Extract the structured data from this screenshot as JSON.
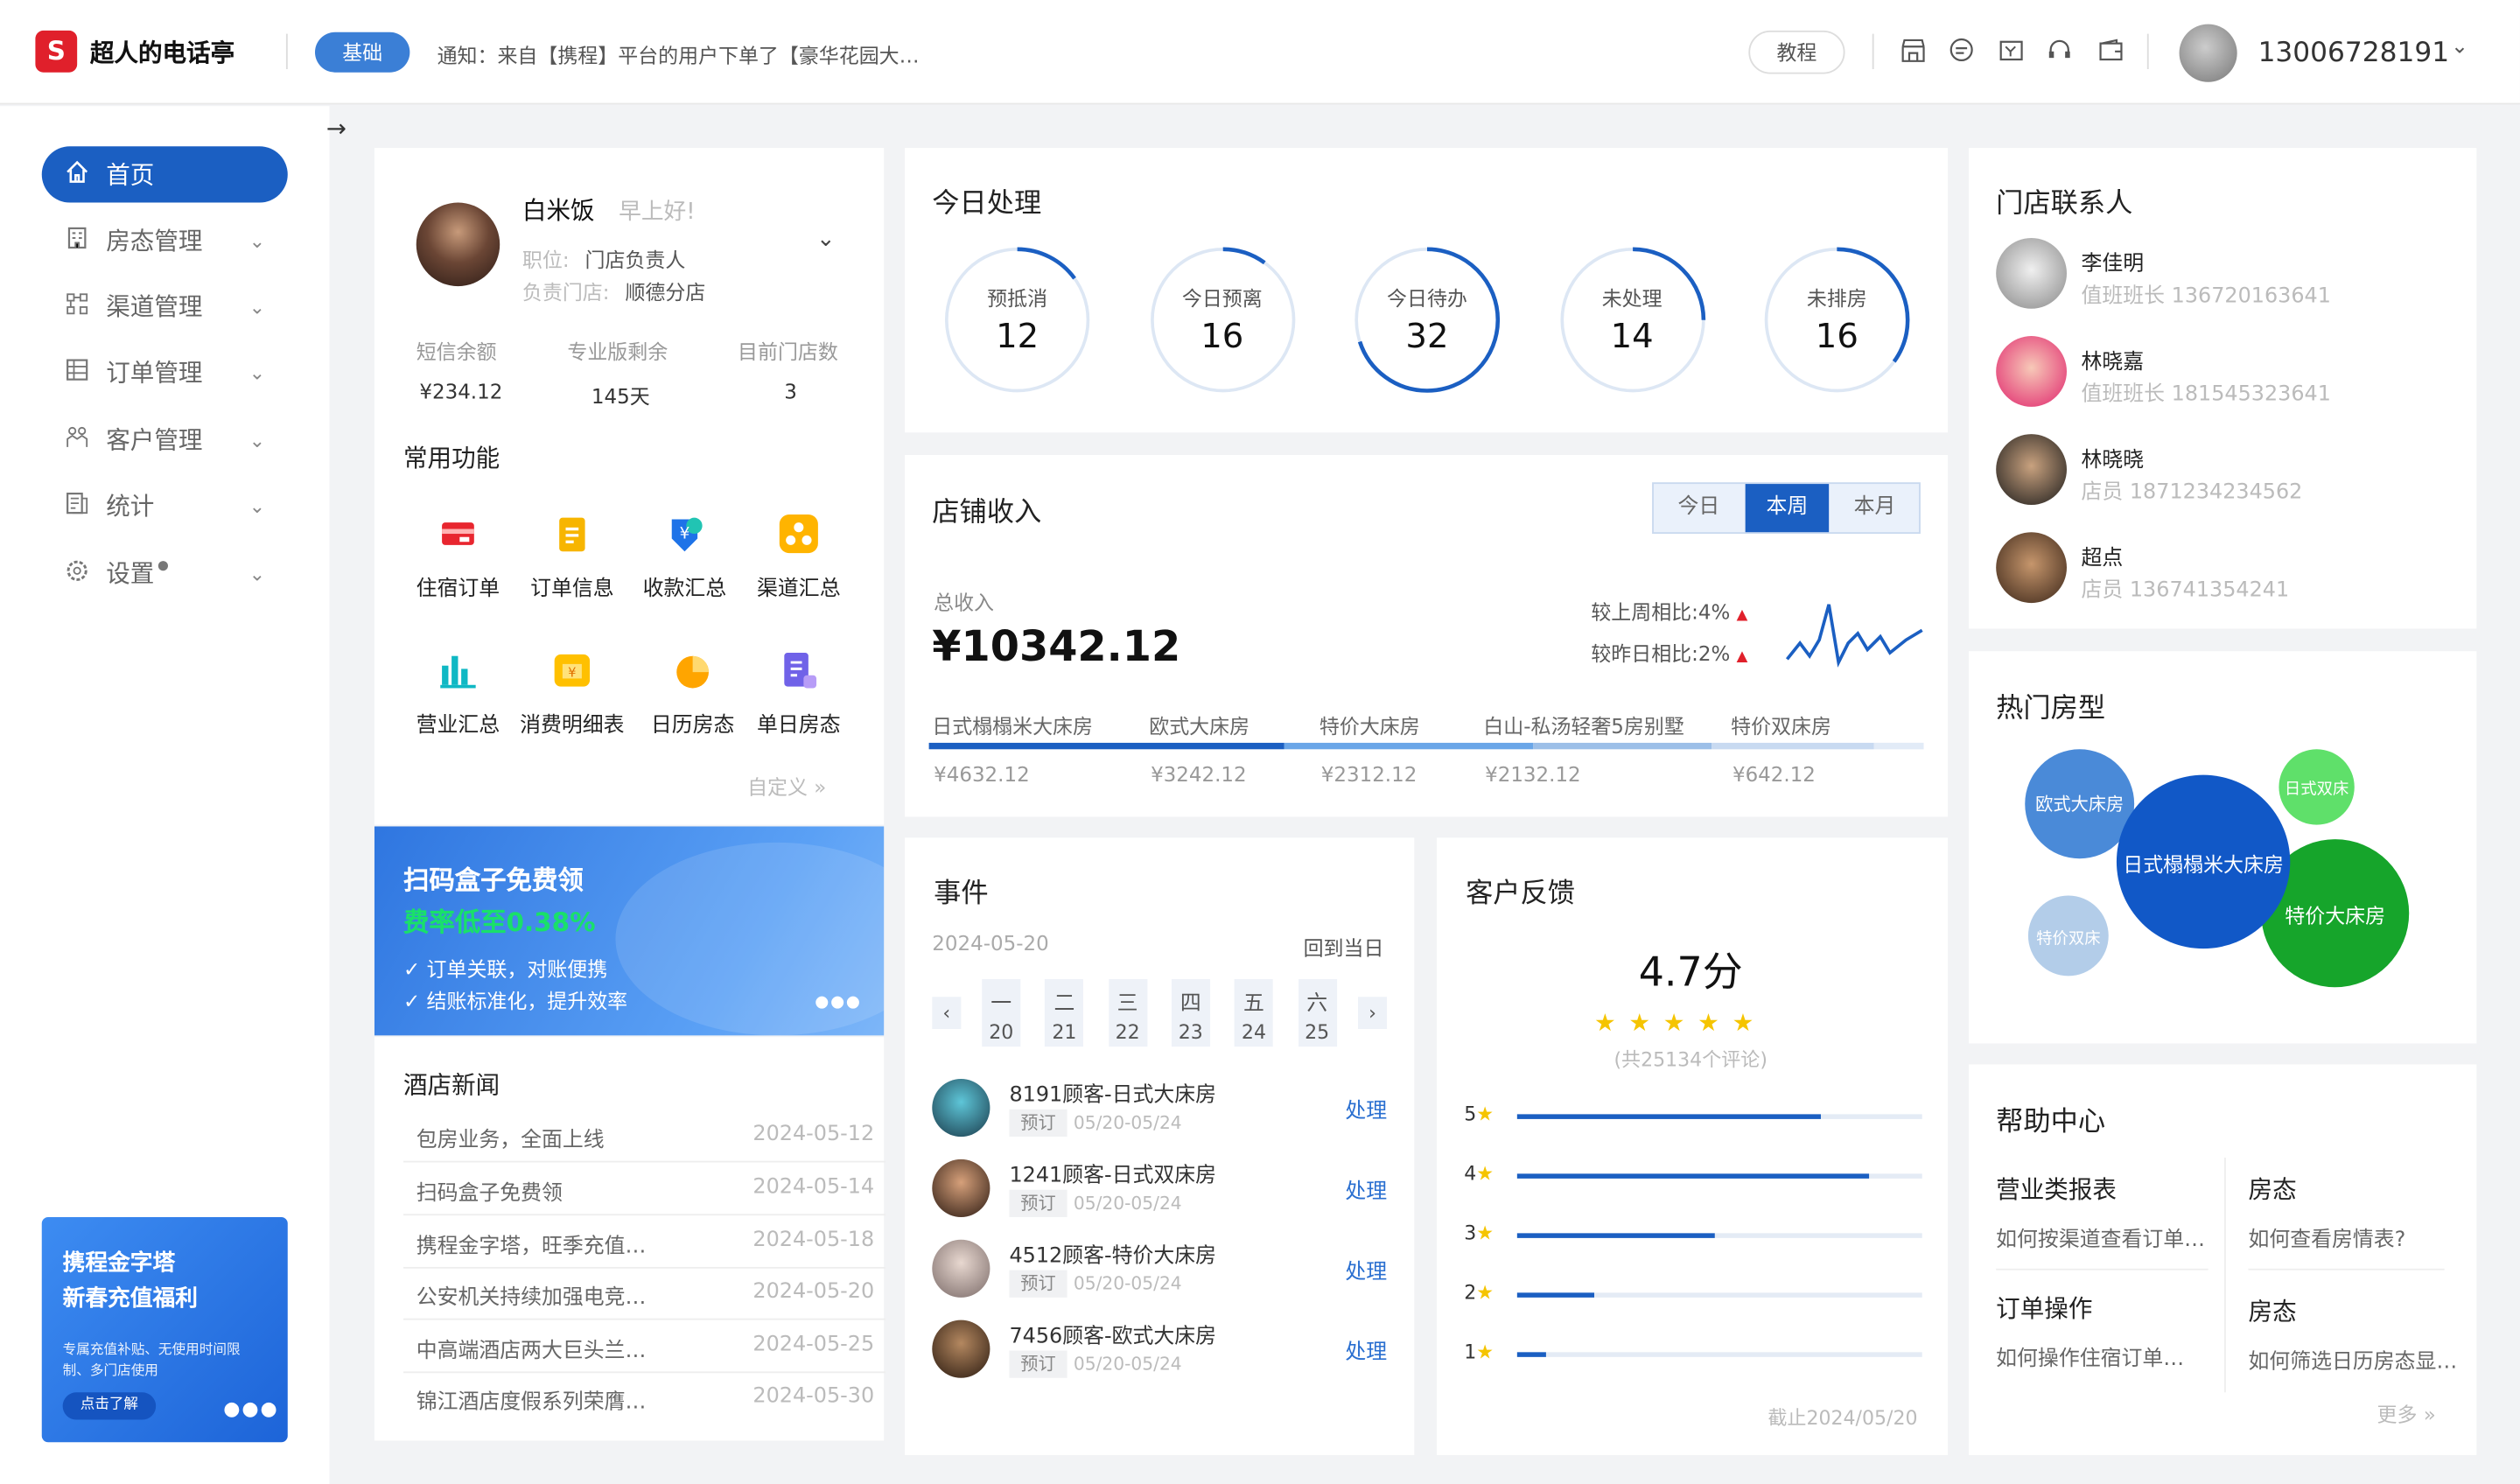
{
  "header": {
    "logo_glyph": "S",
    "app_name": "超人的电话亭",
    "plan_tag": "基础",
    "notice": "通知：来自【携程】平台的用户下单了【豪华花园大…",
    "tutorial": "教程",
    "phone": "13006728191",
    "icons": [
      "store-icon",
      "chat-icon",
      "invoice-icon",
      "headset-icon",
      "wallet-icon"
    ]
  },
  "sidebar": {
    "items": [
      {
        "label": "首页",
        "icon": "home-icon",
        "active": true
      },
      {
        "label": "房态管理",
        "icon": "building-icon"
      },
      {
        "label": "渠道管理",
        "icon": "channel-icon"
      },
      {
        "label": "订单管理",
        "icon": "order-icon"
      },
      {
        "label": "客户管理",
        "icon": "customer-icon"
      },
      {
        "label": "统计",
        "icon": "stats-icon"
      },
      {
        "label": "设置",
        "icon": "settings-icon"
      }
    ],
    "promo": {
      "title_line1": "携程金字塔",
      "title_line2": "新春充值福利",
      "desc_line1": "专属充值补贴、无使用时间限",
      "desc_line2": "制、多门店使用",
      "cta": "点击了解"
    }
  },
  "profile": {
    "name": "白米饭",
    "greeting": "早上好!",
    "position_label": "职位:",
    "position": "门店负责人",
    "store_label": "负责门店:",
    "store": "顺德分店",
    "stats": [
      {
        "label": "短信余额",
        "value": "¥234.12"
      },
      {
        "label": "专业版剩余",
        "value": "145天"
      },
      {
        "label": "目前门店数",
        "value": "3"
      }
    ]
  },
  "functions": {
    "title": "常用功能",
    "items": [
      "住宿订单",
      "订单信息",
      "收款汇总",
      "渠道汇总",
      "营业汇总",
      "消费明细表",
      "日历房态",
      "单日房态"
    ],
    "customize": "自定义"
  },
  "banner": {
    "title": "扫码盒子免费领",
    "highlight": "费率低至0.38%",
    "point1": "订单关联，对账便携",
    "point2": "结账标准化，提升效率"
  },
  "news": {
    "title": "酒店新闻",
    "rows": [
      {
        "title": "包房业务，全面上线",
        "date": "2024-05-12"
      },
      {
        "title": "扫码盒子免费领",
        "date": "2024-05-14"
      },
      {
        "title": "携程金字塔，旺季充值…",
        "date": "2024-05-18"
      },
      {
        "title": "公安机关持续加强电竞…",
        "date": "2024-05-20"
      },
      {
        "title": "中高端酒店两大巨头兰…",
        "date": "2024-05-25"
      },
      {
        "title": "锦江酒店度假系列荣膺…",
        "date": "2024-05-30"
      }
    ]
  },
  "today": {
    "title": "今日处理",
    "items": [
      {
        "label": "预抵消",
        "value": "12",
        "progress": 0.15
      },
      {
        "label": "今日预离",
        "value": "16",
        "progress": 0.1
      },
      {
        "label": "今日待办",
        "value": "32",
        "progress": 0.7
      },
      {
        "label": "未处理",
        "value": "14",
        "progress": 0.25
      },
      {
        "label": "未排房",
        "value": "16",
        "progress": 0.35
      }
    ]
  },
  "revenue": {
    "title": "店铺收入",
    "tabs": [
      "今日",
      "本周",
      "本月"
    ],
    "active_tab": "本周",
    "total_label": "总收入",
    "total": "¥10342.12",
    "wow_label": "较上周相比:",
    "wow": "4%",
    "dod_label": "较昨日相比:",
    "dod": "2%",
    "rooms": [
      {
        "name": "日式榻榻米大床房",
        "value": "¥4632.12",
        "share": 0.448
      },
      {
        "name": "欧式大床房",
        "value": "¥3242.12",
        "share": 0.313
      },
      {
        "name": "特价大床房",
        "value": "¥2312.12",
        "share": 0.224
      },
      {
        "name": "白山-私汤轻奢5房别墅",
        "value": "¥2132.12",
        "share": 0.206
      },
      {
        "name": "特价双床房",
        "value": "¥642.12",
        "share": 0.062
      }
    ]
  },
  "events": {
    "title": "事件",
    "date": "2024-05-20",
    "back": "回到当日",
    "week": [
      {
        "w": "一",
        "d": "20"
      },
      {
        "w": "二",
        "d": "21"
      },
      {
        "w": "三",
        "d": "22"
      },
      {
        "w": "四",
        "d": "23"
      },
      {
        "w": "五",
        "d": "24"
      },
      {
        "w": "六",
        "d": "25"
      }
    ],
    "items": [
      {
        "title": "8191顾客-日式大床房",
        "tag": "预订",
        "dates": "05/20-05/24",
        "action": "处理"
      },
      {
        "title": "1241顾客-日式双床房",
        "tag": "预订",
        "dates": "05/20-05/24",
        "action": "处理"
      },
      {
        "title": "4512顾客-特价大床房",
        "tag": "预订",
        "dates": "05/20-05/24",
        "action": "处理"
      },
      {
        "title": "7456顾客-欧式大床房",
        "tag": "预订",
        "dates": "05/20-05/24",
        "action": "处理"
      }
    ]
  },
  "feedback": {
    "title": "客户反馈",
    "score": "4.7分",
    "count": "(共25134个评论)",
    "cutoff": "截止2024/05/20",
    "rows": [
      {
        "label": "5",
        "fill": 0.75
      },
      {
        "label": "4",
        "fill": 0.87
      },
      {
        "label": "3",
        "fill": 0.49
      },
      {
        "label": "2",
        "fill": 0.19
      },
      {
        "label": "1",
        "fill": 0.07
      }
    ]
  },
  "contacts": {
    "title": "门店联系人",
    "items": [
      {
        "name": "李佳明",
        "role": "值班班长 136720163641"
      },
      {
        "name": "林晓嘉",
        "role": "值班班长 181545323641"
      },
      {
        "name": "林晓晓",
        "role": "店员 1871234234562"
      },
      {
        "name": "超点",
        "role": "店员 136741354241"
      }
    ]
  },
  "hot": {
    "title": "热门房型",
    "items": [
      {
        "name": "欧式大床房",
        "color": "#4a8ad8"
      },
      {
        "name": "日式双床",
        "color": "#5fe06a"
      },
      {
        "name": "日式榻榻米大床房",
        "color": "#1158c7"
      },
      {
        "name": "特价大床房",
        "color": "#16a52b"
      },
      {
        "name": "特价双床",
        "color": "#b3cde9"
      }
    ]
  },
  "help": {
    "title": "帮助中心",
    "items": [
      {
        "title": "营业类报表",
        "desc": "如何按渠道查看订单…"
      },
      {
        "title": "房态",
        "desc": "如何查看房情表?"
      },
      {
        "title": "订单操作",
        "desc": "如何操作住宿订单…"
      },
      {
        "title": "房态",
        "desc": "如何筛选日历房态显…"
      }
    ],
    "more": "更多"
  }
}
